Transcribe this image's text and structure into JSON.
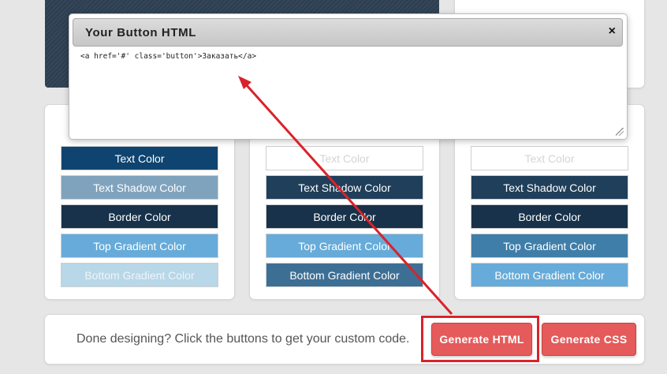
{
  "top_right_panel": {
    "faint_text": ""
  },
  "columns": [
    {
      "buttons": [
        {
          "label": "Text Color",
          "bg": "#0f4470",
          "fg": "#ffffff"
        },
        {
          "label": "Text Shadow Color",
          "bg": "#7fa3bd",
          "fg": "#ffffff"
        },
        {
          "label": "Border Color",
          "bg": "#17324a",
          "fg": "#ffffff"
        },
        {
          "label": "Top Gradient Color",
          "bg": "#66abd9",
          "fg": "#ffffff"
        },
        {
          "label": "Bottom Gradient Color",
          "bg": "#b8d7e8",
          "fg": "#eef5f9"
        }
      ]
    },
    {
      "buttons": [
        {
          "label": "Text Color",
          "bg": "#ffffff",
          "fg": "#d5d5d5"
        },
        {
          "label": "Text Shadow Color",
          "bg": "#1f3f5a",
          "fg": "#ffffff"
        },
        {
          "label": "Border Color",
          "bg": "#17324a",
          "fg": "#ffffff"
        },
        {
          "label": "Top Gradient Color",
          "bg": "#66abd9",
          "fg": "#ffffff"
        },
        {
          "label": "Bottom Gradient Color",
          "bg": "#3d6f95",
          "fg": "#ffffff"
        }
      ]
    },
    {
      "buttons": [
        {
          "label": "Text Color",
          "bg": "#ffffff",
          "fg": "#d5d5d5"
        },
        {
          "label": "Text Shadow Color",
          "bg": "#1f3f5a",
          "fg": "#ffffff"
        },
        {
          "label": "Border Color",
          "bg": "#17324a",
          "fg": "#ffffff"
        },
        {
          "label": "Top Gradient Color",
          "bg": "#3f7ea8",
          "fg": "#ffffff"
        },
        {
          "label": "Bottom Gradient Color",
          "bg": "#66abd9",
          "fg": "#ffffff"
        }
      ]
    }
  ],
  "bottom_bar": {
    "text": "Done designing? Click the buttons to get your custom code.",
    "generate_html_label": "Generate HTML",
    "generate_css_label": "Generate CSS"
  },
  "modal": {
    "title": "Your Button HTML",
    "close_icon": "×",
    "code": "<a href='#' class='button'>Заказать</a>"
  },
  "colors": {
    "generate_button": "#e55a5a",
    "highlight_annotation": "#d9232a"
  }
}
